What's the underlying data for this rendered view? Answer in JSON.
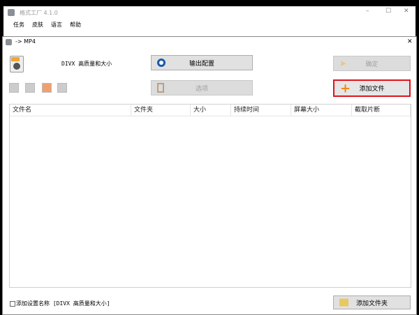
{
  "app": {
    "title": "格式工厂 4.1.0",
    "menu": [
      "任务",
      "皮肤",
      "语言",
      "帮助"
    ]
  },
  "dialog": {
    "title": "-> MP4",
    "preset": "DIVX 高质量和大小",
    "buttons": {
      "output_config": "输出配置",
      "options": "选项",
      "ok": "确定",
      "add_file": "添加文件",
      "add_folder": "添加文件夹"
    },
    "table": {
      "columns": [
        "文件名",
        "文件夹",
        "大小",
        "持续时间",
        "屏幕大小",
        "截取片断"
      ],
      "rows": []
    },
    "checkbox": {
      "label": "添加设置名称 [DIVX 高质量和大小]",
      "checked": false
    }
  },
  "colors": {
    "highlight": "#e0121b"
  }
}
